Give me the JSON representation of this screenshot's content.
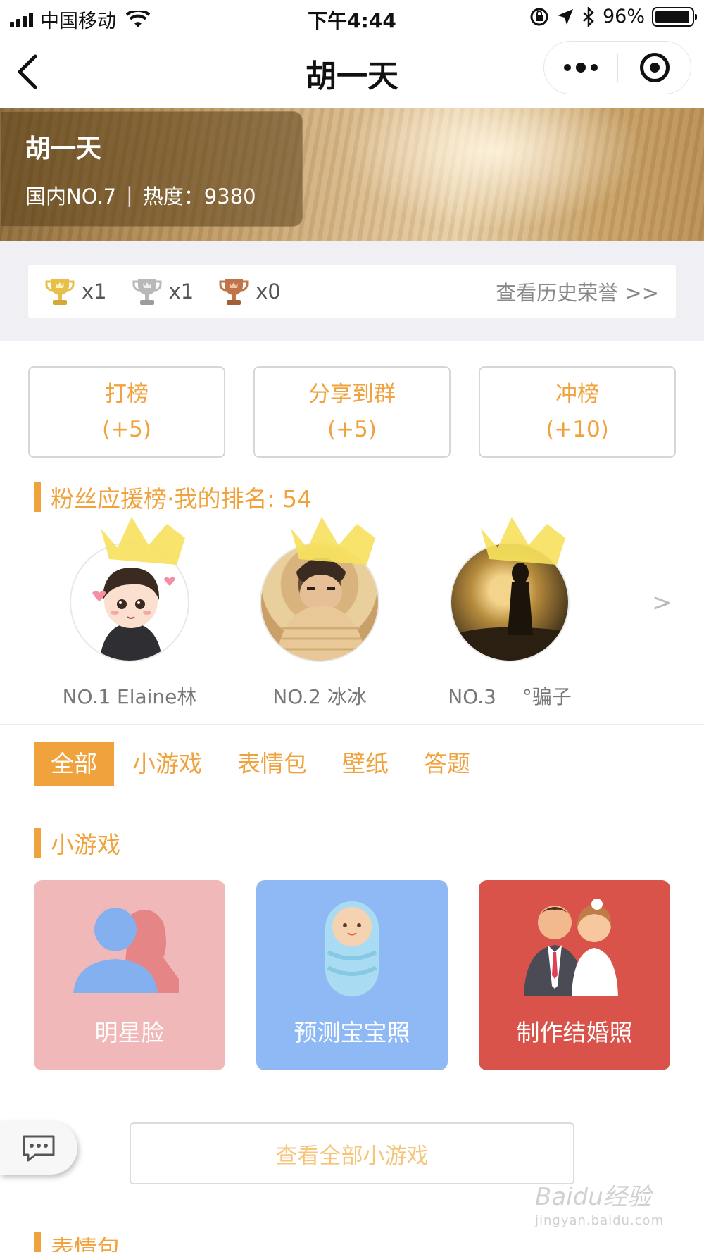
{
  "status_bar": {
    "carrier": "中国移动",
    "time": "下午4:44",
    "battery_percent": "96%",
    "battery_level": 0.96
  },
  "nav": {
    "title": "胡一天"
  },
  "banner": {
    "name": "胡一天",
    "rank": "国内NO.7",
    "separator": "|",
    "heat": "热度：9380"
  },
  "honors": {
    "gold_count": "x1",
    "silver_count": "x1",
    "bronze_count": "x0",
    "history_link": "查看历史荣誉 >>"
  },
  "actions": [
    {
      "label": "打榜",
      "bonus": "(+5)"
    },
    {
      "label": "分享到群",
      "bonus": "(+5)"
    },
    {
      "label": "冲榜",
      "bonus": "(+10)"
    }
  ],
  "fans": {
    "heading": "粉丝应援榜·我的排名: 54",
    "items": [
      {
        "label": "NO.1 Elaine林"
      },
      {
        "label": "NO.2 冰冰"
      },
      {
        "label": "NO.3 　°骗子"
      }
    ],
    "more": ">"
  },
  "tabs": [
    "全部",
    "小游戏",
    "表情包",
    "壁纸",
    "答题"
  ],
  "games": {
    "heading": "小游戏",
    "items": [
      {
        "label": "明星脸"
      },
      {
        "label": "预测宝宝照"
      },
      {
        "label": "制作结婚照"
      }
    ],
    "view_all": "查看全部小游戏"
  },
  "next_section": {
    "heading": "表情包"
  },
  "watermark": {
    "brand": "Baidu经验",
    "url": "jingyan.baidu.com"
  },
  "colors": {
    "accent": "#f0a23c",
    "game_1": "#f0b8b8",
    "game_2": "#8fb9f5",
    "game_3": "#d9534a"
  }
}
